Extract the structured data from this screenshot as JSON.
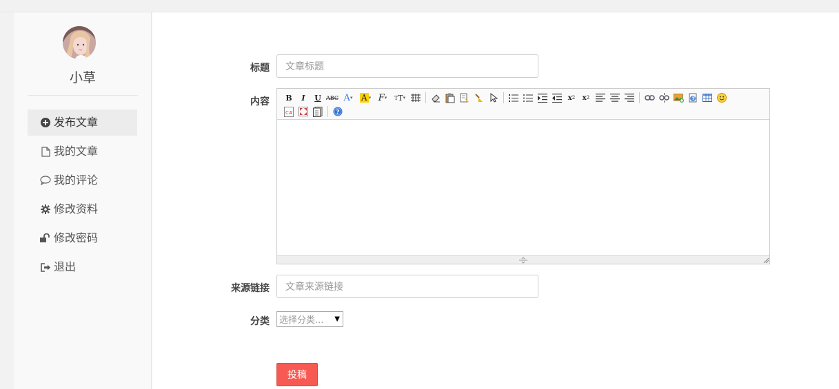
{
  "user": {
    "name": "小草"
  },
  "sidebar": {
    "items": [
      {
        "label": "发布文章",
        "icon": "plus-circle-icon",
        "active": true
      },
      {
        "label": "我的文章",
        "icon": "file-icon"
      },
      {
        "label": "我的评论",
        "icon": "comment-icon"
      },
      {
        "label": "修改资料",
        "icon": "gear-icon"
      },
      {
        "label": "修改密码",
        "icon": "unlock-icon"
      },
      {
        "label": "退出",
        "icon": "sign-out-icon"
      }
    ]
  },
  "form": {
    "title_label": "标题",
    "title_placeholder": "文章标题",
    "content_label": "内容",
    "source_label": "来源链接",
    "source_placeholder": "文章来源链接",
    "category_label": "分类",
    "category_selected": "选择分类...",
    "submit_label": "投稿"
  },
  "editor": {
    "toolbar_row1": [
      "B",
      "I",
      "U",
      "ABC",
      "A",
      "A",
      "F",
      "TT",
      "hr",
      "eraser",
      "paste",
      "paste-text",
      "brush",
      "select",
      "ol",
      "ul",
      "indent",
      "outdent",
      "subscript",
      "superscript",
      "align-left",
      "align-center",
      "align-right",
      "link",
      "unlink",
      "image",
      "flash",
      "table",
      "emoticon"
    ],
    "toolbar_row2": [
      "code",
      "fullscreen",
      "template",
      "help"
    ]
  },
  "colors": {
    "accent": "#f75a52",
    "sidebar_bg": "#f9f9f9",
    "active_bg": "#ececec",
    "border": "#cccccc"
  }
}
